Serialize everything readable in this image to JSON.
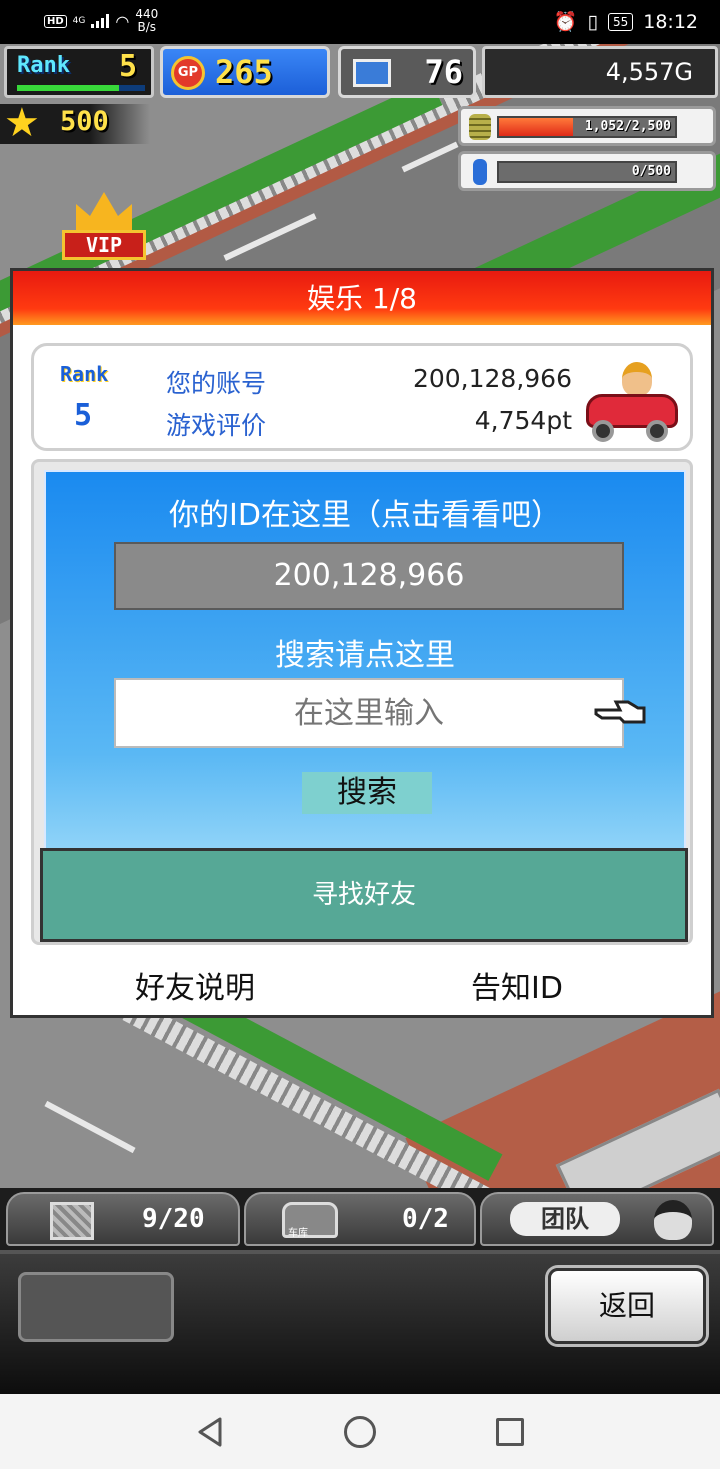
{
  "status_bar": {
    "hd": "HD",
    "net": "4G",
    "speed_value": "440",
    "speed_unit": "B/s",
    "battery": "55",
    "time": "18:12"
  },
  "hud": {
    "rank_label": "Rank",
    "rank_value": "5",
    "rank_progress_pct": 80,
    "gp_icon_text": "GP",
    "gp_value": "265",
    "pc_value": "76",
    "money": "4,557G",
    "stars": "500",
    "resource1_text": "1,052/2,500",
    "resource1_fill_pct": 42,
    "resource2_text": "0/500",
    "resource2_fill_pct": 0,
    "vip_label": "VIP"
  },
  "dialog": {
    "title": "娱乐 1/8",
    "profile": {
      "rank_label": "Rank",
      "rank_value": "5",
      "account_label": "您的账号",
      "account_value": "200,128,966",
      "rating_label": "游戏评价",
      "rating_value": "4,754pt"
    },
    "id_title": "你的ID在这里（点击看看吧）",
    "id_value": "200,128,966",
    "search_title": "搜索请点这里",
    "search_placeholder": "在这里输入",
    "search_button": "搜索",
    "find_friends_button": "寻找好友",
    "friend_info_link": "好友说明",
    "share_id_link": "告知ID"
  },
  "bottom": {
    "tab1_count": "9/20",
    "tab2_label": "车库",
    "tab2_count": "0/2",
    "team_label": "团队",
    "back_button": "返回"
  },
  "colors": {
    "header_red": "#e81a10",
    "panel_blue": "#1a8af0",
    "find_button_green": "#56a896",
    "label_blue": "#2a62d0"
  }
}
